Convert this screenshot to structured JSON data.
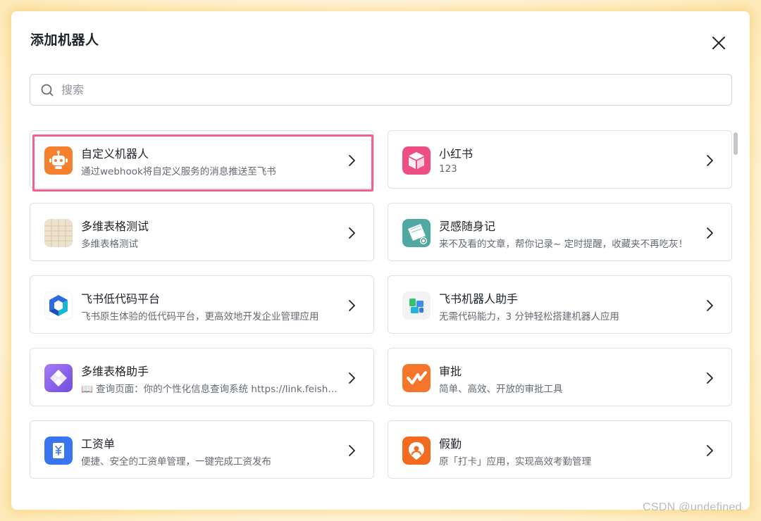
{
  "dialog": {
    "title": "添加机器人",
    "search_placeholder": "搜索"
  },
  "bots": [
    {
      "name": "自定义机器人",
      "desc": "通过webhook将自定义服务的消息推送至飞书",
      "icon": "robot-icon",
      "highlighted": true
    },
    {
      "name": "小红书",
      "desc": "123",
      "icon": "xiaohongshu-box-icon"
    },
    {
      "name": "多维表格测试",
      "desc": "多维表格测试",
      "icon": "table-sheet-icon"
    },
    {
      "name": "灵感随身记",
      "desc": "来不及看的文章，帮你记录~ 定时提醒，收藏夹不再吃灰！",
      "icon": "notebook-icon"
    },
    {
      "name": "飞书低代码平台",
      "desc": "飞书原生体验的低代码平台，更高效地开发企业管理应用",
      "icon": "low-code-icon"
    },
    {
      "name": "飞书机器人助手",
      "desc": "无需代码能力，3 分钟轻松搭建机器人应用",
      "icon": "bot-assistant-icon"
    },
    {
      "name": "多维表格助手",
      "desc": "📖 查询页面：你的个性化信息查询系统 https://link.feishu.cn",
      "icon": "bitable-assistant-icon"
    },
    {
      "name": "审批",
      "desc": "简单、高效、开放的审批工具",
      "icon": "approval-icon"
    },
    {
      "name": "工资单",
      "desc": "便捷、安全的工资单管理，一键完成工资发布",
      "icon": "payslip-icon"
    },
    {
      "name": "假勤",
      "desc": "原「打卡」应用，实现高效考勤管理",
      "icon": "attendance-icon"
    }
  ],
  "watermark": "CSDN @undefined",
  "colors": {
    "highlight": "#f25f95",
    "robot": "#f5812f",
    "xiaohongshu": "#ee4f83",
    "low_code": "#2f6ae0",
    "bitable_assistant": "#8b5cf6",
    "approval": "#f5752a",
    "payslip": "#3a75f0",
    "attendance": "#f36b1f"
  }
}
